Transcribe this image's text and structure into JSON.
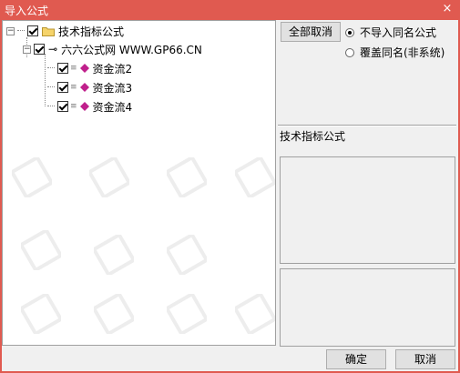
{
  "window": {
    "title": "导入公式",
    "close_symbol": "×",
    "accent_color": "#e05a50"
  },
  "tree": {
    "root": {
      "label": "技术指标公式",
      "expander": "−",
      "checked": true
    },
    "group": {
      "label": "六六公式网 WWW.GP66.CN",
      "expander": "−",
      "checked": true
    },
    "items": [
      {
        "label": "资金流2",
        "checked": true
      },
      {
        "label": "资金流3",
        "checked": true
      },
      {
        "label": "资金流4",
        "checked": true
      }
    ]
  },
  "right_panel": {
    "toggle_all_label": "全部取消",
    "radio_options": [
      {
        "label": "不导入同名公式",
        "selected": true
      },
      {
        "label": "覆盖同名(非系统)",
        "selected": false
      }
    ],
    "category_label": "技术指标公式"
  },
  "footer": {
    "ok_label": "确定",
    "cancel_label": "取消"
  }
}
